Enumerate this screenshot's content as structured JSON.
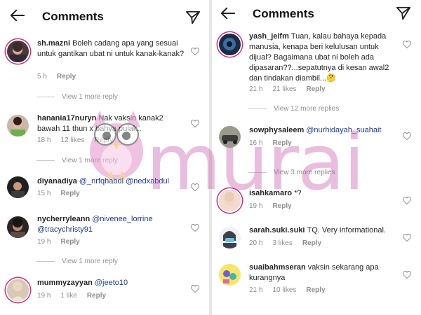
{
  "header": {
    "title": "Comments",
    "back_icon": "back-arrow-icon",
    "send_icon": "send-paper-plane-icon"
  },
  "left": {
    "comments": [
      {
        "user": "sh.mazni",
        "text": "Boleh cadang apa yang sesuai untuk gantikan ubat ni untuk kanak-kanak?",
        "mention": "",
        "time": "5 h",
        "likes": "",
        "reply": "Reply",
        "more": "View 1 more reply"
      },
      {
        "user": "hanania17nuryn",
        "text": "Nak vaksin kanak2 bawah 11 thun x bahya pulak..",
        "mention": "",
        "time": "18 h",
        "likes": "12 likes",
        "reply": "Reply",
        "more": "View 1 more reply"
      },
      {
        "user": "diyanadiya",
        "text": "",
        "mention": "@_nrfqhabdl @nedxabdul",
        "time": "15 h",
        "likes": "",
        "reply": "Reply",
        "more": ""
      },
      {
        "user": "nycherryleann",
        "text": "",
        "mention": "@nivenee_lorrine @tracychristy91",
        "time": "19 h",
        "likes": "",
        "reply": "Reply",
        "more": "View 1 more reply"
      },
      {
        "user": "mummyzayyan",
        "text": "",
        "mention": "@jeeto10",
        "time": "19 h",
        "likes": "1 like",
        "reply": "Reply",
        "more": ""
      }
    ]
  },
  "right": {
    "comments": [
      {
        "user": "yash_jeifm",
        "text": "Tuan, kalau bahaya kepada manusia, kenapa beri kelulusan untuk dijual? Bagaimana ubat ni boleh ada dipasaran??...sepatutnya di kesan awal2 dan tindakan diambil...🤔",
        "mention": "",
        "time": "21 h",
        "likes": "21 likes",
        "reply": "Reply",
        "more": "View 12 more replies"
      },
      {
        "user": "sowphysaleem",
        "text": "",
        "mention": "@nurhidayah_suahait",
        "time": "16 h",
        "likes": "",
        "reply": "Reply",
        "more": "View 3 more replies"
      },
      {
        "user": "isahkamaro",
        "text": "*?",
        "mention": "",
        "time": "19 h",
        "likes": "",
        "reply": "Reply",
        "more": ""
      },
      {
        "user": "sarah.suki.suki",
        "text": "TQ. Very informational.",
        "mention": "",
        "time": "20 h",
        "likes": "3 likes",
        "reply": "Reply",
        "more": ""
      },
      {
        "user": "suaibahmseran",
        "text": "vaksin sekarang apa kurangnya",
        "mention": "",
        "time": "21 h",
        "likes": "10 likes",
        "reply": "Reply",
        "more": ""
      }
    ]
  },
  "watermark": {
    "text": "murai",
    "mascot_icon": "owl-mascot-icon"
  },
  "colors": {
    "ring": "#d62976",
    "mention": "#1e3a8a",
    "muted": "#8e8e8e",
    "watermark": "#c452a8"
  }
}
